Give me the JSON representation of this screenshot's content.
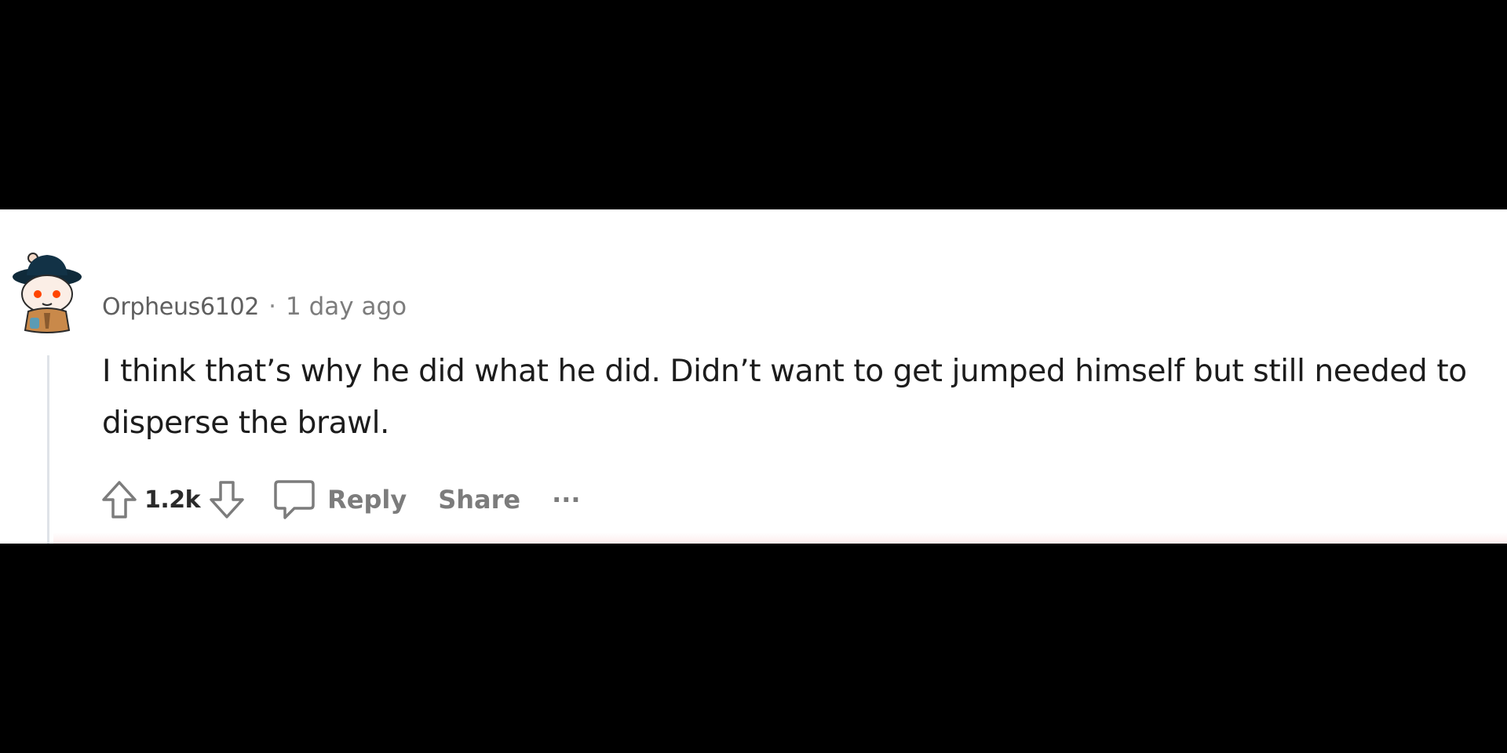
{
  "comment": {
    "author": "Orpheus6102",
    "separator": "·",
    "timestamp": "1 day ago",
    "body": "I think that’s why he did what he did. Didn’t want to get jumped himself but still needed to disperse the brawl.",
    "score": "1.2k",
    "reply_label": "Reply",
    "share_label": "Share",
    "more_label": "···"
  },
  "icons": {
    "avatar": "snoo-avatar-with-hat",
    "upvote": "upvote-arrow-icon",
    "downvote": "downvote-arrow-icon",
    "reply": "comment-bubble-icon"
  },
  "colors": {
    "background": "#ffffff",
    "letterbox": "#000000",
    "text": "#1c1c1c",
    "muted": "#7c7c7c",
    "thread_line": "#dfe3e8"
  }
}
